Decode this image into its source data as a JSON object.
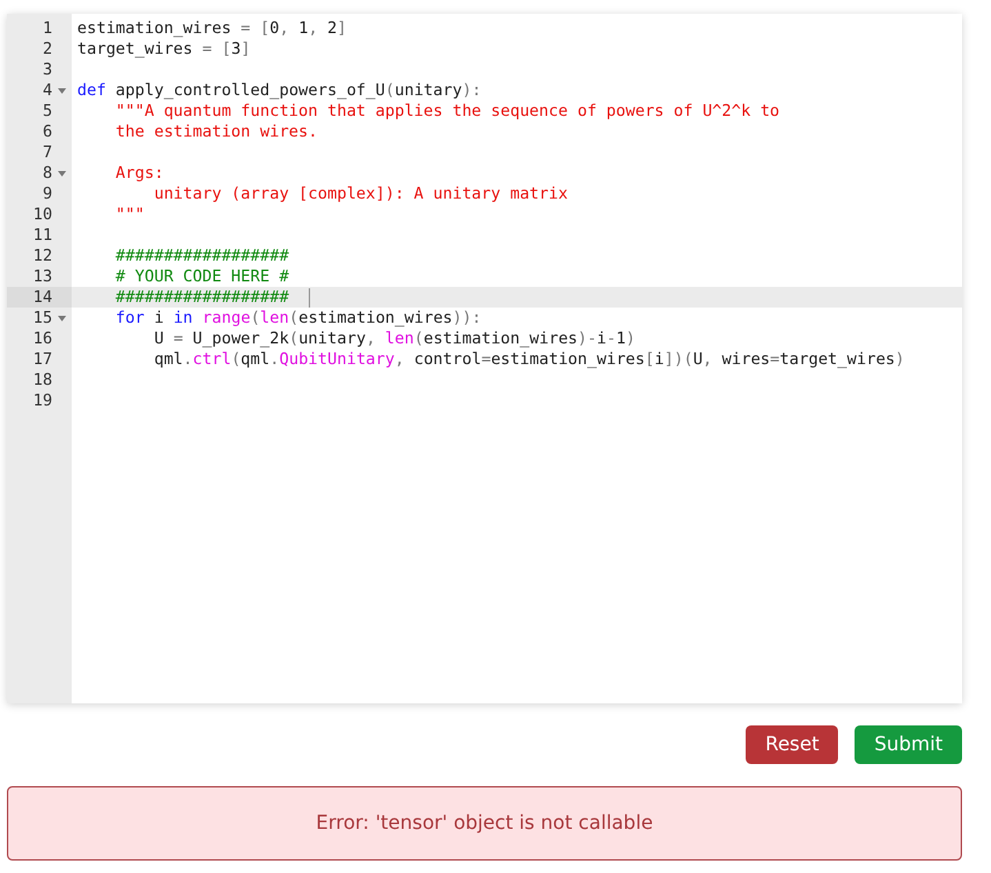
{
  "editor": {
    "lines": [
      {
        "number": "1",
        "foldable": false,
        "active": false,
        "tokens": [
          {
            "kind": "text",
            "text": "estimation_wires "
          },
          {
            "kind": "punct",
            "text": "= ["
          },
          {
            "kind": "text",
            "text": "0"
          },
          {
            "kind": "punct",
            "text": ", "
          },
          {
            "kind": "text",
            "text": "1"
          },
          {
            "kind": "punct",
            "text": ", "
          },
          {
            "kind": "text",
            "text": "2"
          },
          {
            "kind": "punct",
            "text": "]"
          }
        ]
      },
      {
        "number": "2",
        "foldable": false,
        "active": false,
        "tokens": [
          {
            "kind": "text",
            "text": "target_wires "
          },
          {
            "kind": "punct",
            "text": "= ["
          },
          {
            "kind": "text",
            "text": "3"
          },
          {
            "kind": "punct",
            "text": "]"
          }
        ]
      },
      {
        "number": "3",
        "foldable": false,
        "active": false
      },
      {
        "number": "4",
        "foldable": true,
        "active": false,
        "tokens": [
          {
            "kind": "keyword",
            "text": "def"
          },
          {
            "kind": "text",
            "text": " apply_controlled_powers_of_U"
          },
          {
            "kind": "punct",
            "text": "("
          },
          {
            "kind": "text",
            "text": "unitary"
          },
          {
            "kind": "punct",
            "text": "):"
          }
        ]
      },
      {
        "number": "5",
        "foldable": false,
        "active": false,
        "tokens": [
          {
            "kind": "string",
            "text": "    \"\"\"A quantum function that applies the sequence of powers of U^2^k to"
          }
        ]
      },
      {
        "number": "6",
        "foldable": false,
        "active": false,
        "tokens": [
          {
            "kind": "string",
            "text": "    the estimation wires."
          }
        ]
      },
      {
        "number": "7",
        "foldable": false,
        "active": false
      },
      {
        "number": "8",
        "foldable": true,
        "active": false,
        "tokens": [
          {
            "kind": "string",
            "text": "    Args:"
          }
        ]
      },
      {
        "number": "9",
        "foldable": false,
        "active": false,
        "tokens": [
          {
            "kind": "string",
            "text": "        unitary (array [complex]): A unitary matrix"
          }
        ]
      },
      {
        "number": "10",
        "foldable": false,
        "active": false,
        "tokens": [
          {
            "kind": "string",
            "text": "    \"\"\""
          }
        ]
      },
      {
        "number": "11",
        "foldable": false,
        "active": false
      },
      {
        "number": "12",
        "foldable": false,
        "active": false,
        "tokens": [
          {
            "kind": "comment",
            "text": "    ##################"
          }
        ]
      },
      {
        "number": "13",
        "foldable": false,
        "active": false,
        "tokens": [
          {
            "kind": "comment",
            "text": "    # YOUR CODE HERE #"
          }
        ]
      },
      {
        "number": "14",
        "foldable": false,
        "active": true,
        "tokens": [
          {
            "kind": "comment",
            "text": "    ##################"
          }
        ]
      },
      {
        "number": "15",
        "foldable": true,
        "active": false,
        "tokens": [
          {
            "kind": "keyword",
            "text": "    for"
          },
          {
            "kind": "text",
            "text": " i "
          },
          {
            "kind": "keyword",
            "text": "in"
          },
          {
            "kind": "builtin",
            "text": " range"
          },
          {
            "kind": "punct",
            "text": "("
          },
          {
            "kind": "builtin",
            "text": "len"
          },
          {
            "kind": "punct",
            "text": "("
          },
          {
            "kind": "text",
            "text": "estimation_wires"
          },
          {
            "kind": "punct",
            "text": ")):"
          }
        ]
      },
      {
        "number": "16",
        "foldable": false,
        "active": false,
        "tokens": [
          {
            "kind": "text",
            "text": "        U "
          },
          {
            "kind": "punct",
            "text": "="
          },
          {
            "kind": "text",
            "text": " U_power_2k"
          },
          {
            "kind": "punct",
            "text": "("
          },
          {
            "kind": "text",
            "text": "unitary"
          },
          {
            "kind": "punct",
            "text": ", "
          },
          {
            "kind": "builtin",
            "text": "len"
          },
          {
            "kind": "punct",
            "text": "("
          },
          {
            "kind": "text",
            "text": "estimation_wires"
          },
          {
            "kind": "punct",
            "text": ")-"
          },
          {
            "kind": "text",
            "text": "i"
          },
          {
            "kind": "punct",
            "text": "-"
          },
          {
            "kind": "text",
            "text": "1"
          },
          {
            "kind": "punct",
            "text": ")"
          }
        ]
      },
      {
        "number": "17",
        "foldable": false,
        "active": false,
        "tokens": [
          {
            "kind": "text",
            "text": "        qml"
          },
          {
            "kind": "punct",
            "text": "."
          },
          {
            "kind": "builtin",
            "text": "ctrl"
          },
          {
            "kind": "punct",
            "text": "("
          },
          {
            "kind": "text",
            "text": "qml"
          },
          {
            "kind": "punct",
            "text": "."
          },
          {
            "kind": "builtin",
            "text": "QubitUnitary"
          },
          {
            "kind": "punct",
            "text": ", "
          },
          {
            "kind": "text",
            "text": "control"
          },
          {
            "kind": "punct",
            "text": "="
          },
          {
            "kind": "text",
            "text": "estimation_wires"
          },
          {
            "kind": "punct",
            "text": "["
          },
          {
            "kind": "text",
            "text": "i"
          },
          {
            "kind": "punct",
            "text": "])("
          },
          {
            "kind": "text",
            "text": "U"
          },
          {
            "kind": "punct",
            "text": ", "
          },
          {
            "kind": "text",
            "text": "wires"
          },
          {
            "kind": "punct",
            "text": "="
          },
          {
            "kind": "text",
            "text": "target_wires"
          },
          {
            "kind": "punct",
            "text": ")"
          }
        ]
      },
      {
        "number": "18",
        "foldable": false,
        "active": false
      },
      {
        "number": "19",
        "foldable": false,
        "active": false
      }
    ]
  },
  "buttons": [
    {
      "kind": "danger",
      "label": "Reset"
    },
    {
      "kind": "success",
      "label": "Submit"
    }
  ],
  "error": {
    "message": "Error: 'tensor' object is not callable"
  }
}
